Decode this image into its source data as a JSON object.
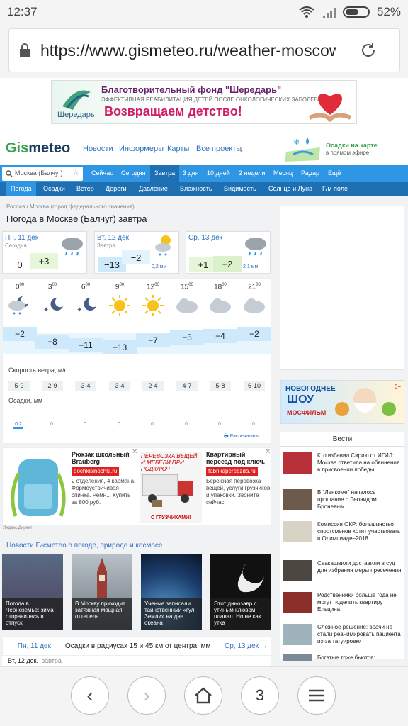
{
  "status": {
    "time": "12:37",
    "battery": "52%"
  },
  "browser": {
    "url": "https://www.gismeteo.ru/weather-moscow",
    "tab_count": "3"
  },
  "top_ad": {
    "title": "Благотворительный фонд \"Шередарь\"",
    "subtitle": "ЭФФЕКТИВНАЯ РЕАБИЛИТАЦИЯ ДЕТЕЙ ПОСЛЕ ОНКОЛОГИЧЕСКИХ ЗАБОЛЕВАНИЙ",
    "slogan": "Возвращаем детство!",
    "brand": "Шередарь"
  },
  "header": {
    "logo_gis": "Gis",
    "logo_meteo": "meteo",
    "nav": [
      "Новости",
      "Информеры",
      "Карты",
      "Все проекты"
    ],
    "map_promo_title": "Осадки на карте",
    "map_promo_sub": "в прямом эфире"
  },
  "search": {
    "value": "Москва (Балчуг)"
  },
  "tabs_primary": [
    "Сейчас",
    "Сегодня",
    "Завтра",
    "3 дня",
    "10 дней",
    "2 недели",
    "Месяц",
    "Радар",
    "Ещё"
  ],
  "tabs_primary_active": "Завтра",
  "tabs_secondary": [
    "Погода",
    "Осадки",
    "Ветер",
    "Дороги",
    "Давление",
    "Влажность",
    "Видимость",
    "Солнце и Луна",
    "Г/м поле"
  ],
  "tabs_secondary_active": "Погода",
  "breadcrumb": {
    "a": "Россия",
    "sep": "/",
    "b": "Москва (город федерального значения)"
  },
  "page_title": "Погода в Москве (Балчуг) завтра",
  "days": [
    {
      "label": "Пн, 11 дек",
      "sub": "Сегодня",
      "t_low": "0",
      "t_high": "+3",
      "precip": ""
    },
    {
      "label": "Вт, 12 дек",
      "sub": "Завтра",
      "t_low": "−13",
      "t_high": "−2",
      "precip": "0,2 мм"
    },
    {
      "label": "Ср, 13 дек",
      "sub": "",
      "t_low": "+1",
      "t_high": "+2",
      "precip": "2,1 мм"
    }
  ],
  "hourly": {
    "hours": [
      "0",
      "3",
      "6",
      "9",
      "12",
      "15",
      "18",
      "21"
    ],
    "minutes": "00",
    "icons": [
      "cloud-snow-moon-icon",
      "moon-stars-icon",
      "moon-stars-icon",
      "sun-icon",
      "sun-icon",
      "cloud-icon",
      "cloud-icon",
      "cloud-icon"
    ],
    "temps": [
      "−2",
      "−8",
      "−11",
      "−13",
      "−7",
      "−5",
      "−4",
      "−2"
    ],
    "wind_label": "Скорость ветра, м/с",
    "wind": [
      "5-9",
      "2-9",
      "3-4",
      "3-4",
      "2-4",
      "4-7",
      "5-8",
      "6-10"
    ],
    "precip_label": "Осадки, мм",
    "precip": [
      "0,2",
      "0",
      "0",
      "0",
      "0",
      "0",
      "0",
      "0"
    ],
    "print_label": "Распечатать..."
  },
  "left_ads": [
    {
      "title": "Рюкзак школьный Brauberg",
      "domain": "dochkisinochki.ru",
      "text": "2 отделения, 4 кармана. Формоустойчивая спинка. Ремн... Купить за 800 руб."
    },
    {
      "title": "ПЕРЕВОЗКА ВЕЩЕЙ И МЕБЕЛИ ПРИ ПОДКЛЮЧ",
      "domain": "",
      "text": "С ГРУЗЧИКАМИ!"
    },
    {
      "title": "Квартирный переезд под ключ.",
      "domain": "fabrikapereezda.ru",
      "text": "Бережная перевозка вещей, услуги грузчиков и упаковки. Звоните сейчас!"
    }
  ],
  "yandex_label": "Яндекс.Директ",
  "news_heading": "Новости Гисметео о погоде, природе и космосе",
  "news": [
    "Погода в Черноземье: зима отправилась в отпуск",
    "В Москву приходит затяжная мощная оттепель",
    "Ученые записали таинственный «гул Земли» на дне океана",
    "Этот динозавр с утиным клювом плавал. Но не как утка"
  ],
  "precip_nav": {
    "prev": "Пн, 11 дек",
    "center": "Осадки в радиусах 15 и 45 км от центра, мм",
    "next": "Ср, 13 дек"
  },
  "bottom_day": {
    "day": "Вт, 12 дек.",
    "sub": "завтра"
  },
  "right_banner": {
    "line1": "НОВОГОДНЕЕ",
    "line2": "ШОУ",
    "line3": "МОСФИЛЬМ",
    "age": "6+"
  },
  "vesti": {
    "title": "Вести",
    "items": [
      "Кто избавил Сирию от ИГИЛ: Москва ответила на обвинения в присвоении победы",
      "В \"Ленкоме\" началось прощание с Леонидом Броневым",
      "Комиссия ОКР: большинство спортсменов хотят участвовать в Олимпиаде–2018",
      "Саакашвили доставили в суд для избрания меры пресечения",
      "Родственники больше года не могут поделить квартиру Ельцина",
      "Сложное решение: врачи не стали реанимировать пациента из-за татуировки",
      "Богатые тоже бьются:"
    ]
  },
  "colors": {
    "blue": "#2f96e3",
    "dark_blue": "#1f6fb3",
    "link": "#2f72c2",
    "green": "#37a449",
    "temp_fill": "#cde9fb"
  }
}
